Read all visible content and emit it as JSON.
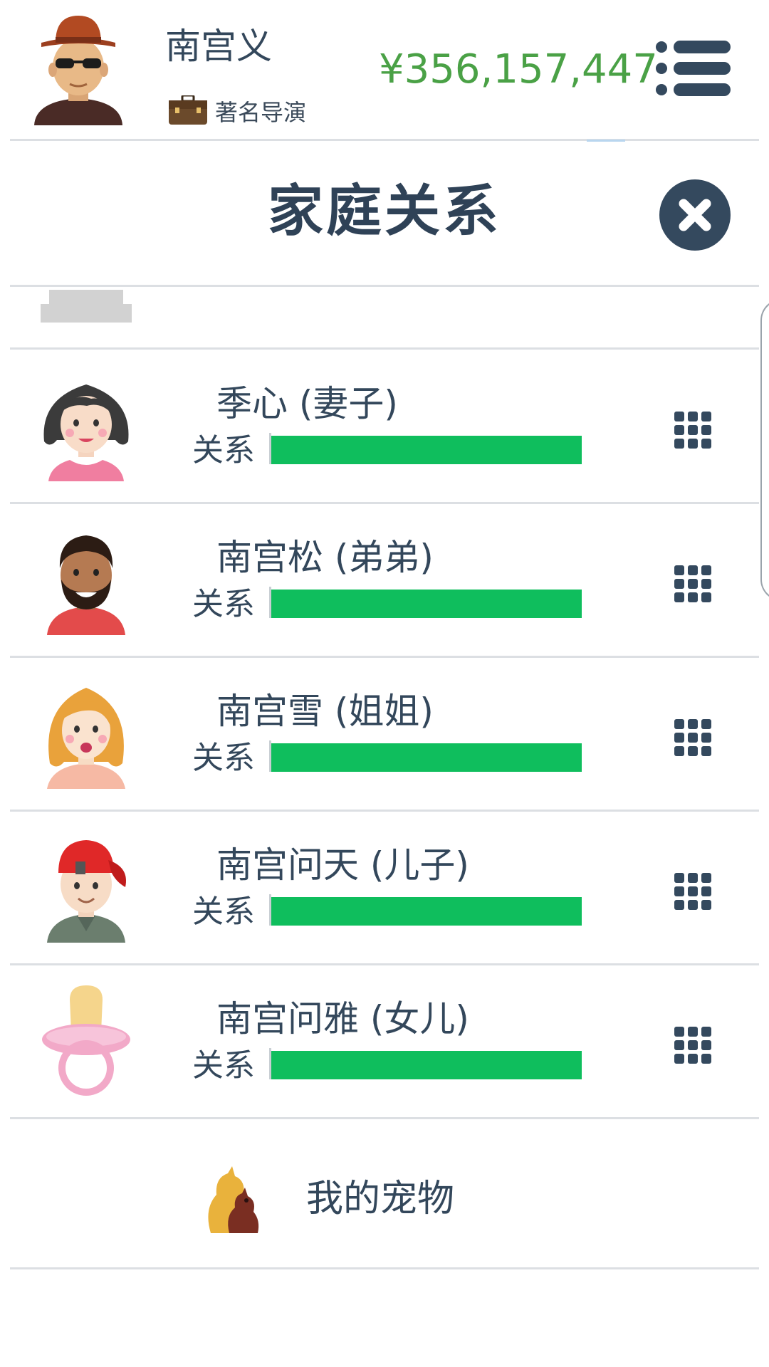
{
  "header": {
    "player_name": "南宫义",
    "job_title": "著名导演",
    "money": "¥356,157,447",
    "avatar_icon": "player-avatar-sunglasses-hat",
    "job_icon": "briefcase-icon",
    "menu_icon": "list-menu-icon"
  },
  "dialog": {
    "title": "家庭关系",
    "close_icon": "close-icon"
  },
  "members": [
    {
      "name": "季心 (妻子)",
      "bar_label": "关系",
      "relationship": 1.0,
      "avatar": "wife-avatar"
    },
    {
      "name": "南宫松 (弟弟)",
      "bar_label": "关系",
      "relationship": 1.0,
      "avatar": "brother-avatar"
    },
    {
      "name": "南宫雪 (姐姐)",
      "bar_label": "关系",
      "relationship": 1.0,
      "avatar": "sister-avatar"
    },
    {
      "name": "南宫问天 (儿子)",
      "bar_label": "关系",
      "relationship": 1.0,
      "avatar": "son-avatar"
    },
    {
      "name": "南宫问雅 (女儿)",
      "bar_label": "关系",
      "relationship": 1.0,
      "avatar": "baby-pacifier-avatar"
    }
  ],
  "pets": {
    "label": "我的宠物",
    "icon": "dog-icon"
  },
  "colors": {
    "money": "#4aa146",
    "bar_fill": "#0fbe5d",
    "dark": "#34495e",
    "divider": "#dcdfe3"
  }
}
